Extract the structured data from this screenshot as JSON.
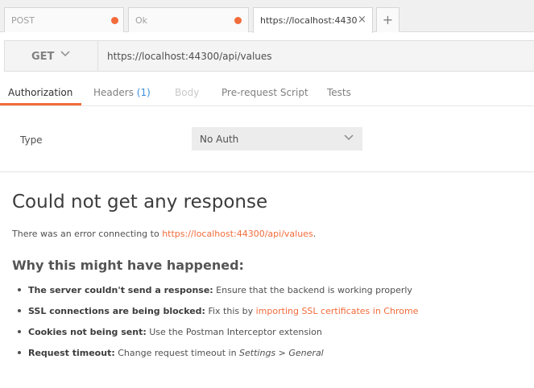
{
  "tabs": [
    {
      "label": "POST",
      "modified": true
    },
    {
      "label": "Ok",
      "modified": true
    },
    {
      "label": "https://localhost:4430",
      "active": true
    }
  ],
  "new_tab_label": "+",
  "close_glyph": "×",
  "request": {
    "method": "GET",
    "url": "https://localhost:44300/api/values"
  },
  "sub_tabs": {
    "authorization": "Authorization",
    "headers": "Headers",
    "headers_count": "(1)",
    "body": "Body",
    "prerequest": "Pre-request Script",
    "tests": "Tests"
  },
  "auth": {
    "type_label": "Type",
    "type_value": "No Auth"
  },
  "error": {
    "title": "Could not get any response",
    "desc_prefix": "There was an error connecting to ",
    "desc_link": "https://localhost:44300/api/values",
    "desc_suffix": ".",
    "why_title": "Why this might have happened:",
    "reasons": [
      {
        "bold": "The server couldn't send a response:",
        "text": " Ensure that the backend is working properly"
      },
      {
        "bold": "SSL connections are being blocked:",
        "text": " Fix this by ",
        "link": "importing SSL certificates in Chrome"
      },
      {
        "bold": "Cookies not being sent:",
        "text": " Use the Postman Interceptor extension"
      },
      {
        "bold": "Request timeout:",
        "text": " Change request timeout in ",
        "italic1": "Settings",
        "sep": " > ",
        "italic2": "General"
      }
    ]
  },
  "colors": {
    "accent": "#f26b3a",
    "count_blue": "#3b8ede"
  },
  "icons": {
    "modified_dot": "orange-dot-icon",
    "close": "close-icon",
    "add_tab": "plus-icon",
    "method_dropdown": "chevron-down-icon",
    "auth_dropdown": "chevron-down-icon"
  }
}
